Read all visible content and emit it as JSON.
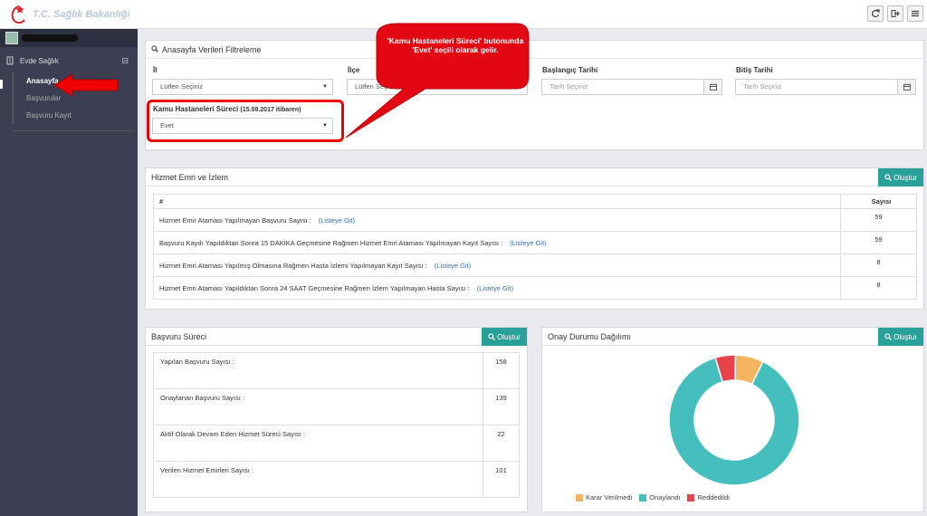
{
  "app": {
    "title": "T.C. Sağlık Bakanlığı"
  },
  "topbar": {
    "icons": [
      "refresh-icon",
      "logout-icon",
      "menu-icon"
    ]
  },
  "sidebar": {
    "group_label": "Evde Sağlık",
    "items": [
      {
        "label": "Anasayfa",
        "active": true
      },
      {
        "label": "Başvurular",
        "active": false
      },
      {
        "label": "Başvuru Kayıt",
        "active": false
      }
    ]
  },
  "filter": {
    "title": "Anasayfa Verileri Filtreleme",
    "il_label": "İl",
    "il_value": "Lütfen Seçiniz",
    "ilce_label": "İlçe",
    "ilce_value": "Lütfen Seçiniz",
    "start_label": "Başlangıç Tarihi",
    "start_placeholder": "Tarih Seçiniz",
    "end_label": "Bitiş Tarihi",
    "end_placeholder": "Tarih Seçiniz",
    "kamu_label": "Kamu Hastaneleri Süreci",
    "kamu_note": "(15.08.2017 itibaren)",
    "kamu_value": "Evet"
  },
  "callout": {
    "text": "'Kamu Hastaneleri Süreci' butonunda 'Evet' seçili olarak gelir."
  },
  "hizmet": {
    "title": "Hizmet Emri ve İzlem",
    "button": "Oluştur",
    "col_hash": "#",
    "col_count": "Sayısı",
    "link_text": "(Listeye Git)",
    "rows": [
      {
        "label": "Hizmet Emir Ataması Yapılmayan Başvuru Sayısı :",
        "count": "59"
      },
      {
        "label": "Başvuru Kaydı Yapıldıktan Sonra 15 DAKİKA Geçmesine Rağmen Hizmet Emri Ataması Yapılmayan Kayıt Sayısı :",
        "count": "59"
      },
      {
        "label": "Hizmet Emri Ataması Yapılmış Olmasına Rağmen Hasta İzlemi Yapılmayan Kayıt Sayısı :",
        "count": "8"
      },
      {
        "label": "Hizmet Emri Ataması Yapıldıktan Sonra 24 SAAT Geçmesine Rağmen İzlem Yapılmayan Hasta Sayısı :",
        "count": "8"
      }
    ]
  },
  "basvuru": {
    "title": "Başvuru Süreci",
    "button": "Oluştur",
    "rows": [
      {
        "label": "Yapılan Başvuru Sayısı :",
        "value": "158"
      },
      {
        "label": "Onaylanan Başvuru Sayısı :",
        "value": "139"
      },
      {
        "label": "Aktif Olarak Devam Eden Hizmet Süreci Sayısı :",
        "value": "22"
      },
      {
        "label": "Verilen Hizmet Emirleri Sayısı :",
        "value": "101"
      }
    ]
  },
  "onay": {
    "title": "Onay Durumu Dağılımı",
    "button": "Oluştur"
  },
  "chart_data": {
    "type": "pie",
    "categories": [
      "Karar Verilmedi",
      "Onaylandı",
      "Reddedildi"
    ],
    "values": [
      7,
      88,
      5
    ],
    "colors": [
      "#f5b45f",
      "#45bfbd",
      "#e8434a"
    ],
    "legend_position": "bottom"
  },
  "colors": {
    "accent": "#2aa198",
    "highlight": "#e00000",
    "sidebar": "#3b3f51"
  }
}
